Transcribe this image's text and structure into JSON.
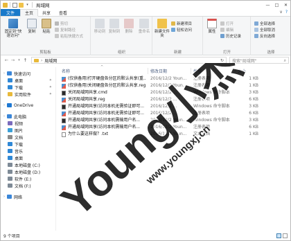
{
  "window": {
    "title": "局域网",
    "controls": [
      "—",
      "□",
      "✕"
    ]
  },
  "ribbon_tabs": {
    "file": "文件",
    "home": "主页",
    "share": "共享",
    "view": "查看",
    "collapse": "∨",
    "help": "?"
  },
  "ribbon": {
    "clipboard": {
      "label": "剪贴板",
      "pin": "固定到\"快速访问\"",
      "copy": "复制",
      "paste": "粘贴",
      "cut": "剪切",
      "copy_path": "复制路径",
      "paste_shortcut": "粘贴快捷方式"
    },
    "organize": {
      "label": "组织",
      "move_to": "移动到",
      "copy_to": "复制到",
      "delete": "删除",
      "rename": "重命名"
    },
    "new": {
      "label": "新建",
      "new_folder": "新建文件夹",
      "new_item": "新建项目",
      "easy_access": "轻松访问"
    },
    "open": {
      "label": "打开",
      "properties": "属性",
      "open": "打开",
      "edit": "编辑",
      "history": "历史记录"
    },
    "select": {
      "label": "选择",
      "select_all": "全部选择",
      "select_none": "全部取消",
      "invert": "反向选择"
    }
  },
  "address": {
    "back": "←",
    "forward": "→",
    "up": "↑",
    "path": "局域网",
    "refresh": "↻",
    "search_placeholder": "搜索\"局域网\"",
    "search_icon": "search-icon"
  },
  "nav_pane": {
    "items": [
      {
        "label": "快速访问",
        "icon": "star-icon",
        "color": "#3a86d8",
        "level": 0,
        "pinned": false
      },
      {
        "label": "桌面",
        "icon": "desktop-icon",
        "color": "#2f88d6",
        "level": 1,
        "pinned": true
      },
      {
        "label": "下载",
        "icon": "download-icon",
        "color": "#2f88d6",
        "level": 1,
        "pinned": true
      },
      {
        "label": "实用软件",
        "icon": "folder-icon",
        "color": "#e8b93a",
        "level": 1,
        "pinned": true
      },
      {
        "label": "OneDrive",
        "icon": "cloud-icon",
        "color": "#1e78d2",
        "level": 0,
        "pinned": false
      },
      {
        "label": "此电脑",
        "icon": "computer-icon",
        "color": "#3a86d8",
        "level": 0,
        "pinned": false
      },
      {
        "label": "视频",
        "icon": "video-icon",
        "color": "#7a6bbd",
        "level": 1,
        "pinned": false
      },
      {
        "label": "图片",
        "icon": "picture-icon",
        "color": "#3aa0d8",
        "level": 1,
        "pinned": false
      },
      {
        "label": "文档",
        "icon": "document-icon",
        "color": "#8a8a8a",
        "level": 1,
        "pinned": false
      },
      {
        "label": "下载",
        "icon": "download-icon",
        "color": "#2f88d6",
        "level": 1,
        "pinned": false
      },
      {
        "label": "音乐",
        "icon": "music-icon",
        "color": "#2f88d6",
        "level": 1,
        "pinned": false
      },
      {
        "label": "桌面",
        "icon": "desktop-icon",
        "color": "#2f88d6",
        "level": 1,
        "pinned": false
      },
      {
        "label": "本地磁盘 (C:)",
        "icon": "drive-icon",
        "color": "#7e8a96",
        "level": 1,
        "pinned": false
      },
      {
        "label": "本地磁盘 (D:)",
        "icon": "drive-icon",
        "color": "#7e8a96",
        "level": 1,
        "pinned": false
      },
      {
        "label": "软件 (E:)",
        "icon": "drive-icon",
        "color": "#7e8a96",
        "level": 1,
        "pinned": false
      },
      {
        "label": "文档 (F:)",
        "icon": "drive-icon",
        "color": "#7e8a96",
        "level": 1,
        "pinned": false
      },
      {
        "label": "网络",
        "icon": "network-icon",
        "color": "#3a86d8",
        "level": 0,
        "pinned": false
      }
    ]
  },
  "file_list": {
    "sort_caret": "^",
    "columns": {
      "name": "名称",
      "date": "修改日期",
      "type": "类型",
      "size": "大小"
    },
    "rows": [
      {
        "name": "(仅供备用)打开硬盘各分区的默认共享(重...",
        "date": "2016/12/2 Youn...",
        "type": "注册表项",
        "size": "1 KB",
        "icon": "reg-icon"
      },
      {
        "name": "(仅供备用)关闭硬盘各分区的默认共享.reg",
        "date": "2016/12/2 Youn...",
        "type": "注册表项",
        "size": "1 KB",
        "icon": "reg-icon"
      },
      {
        "name": "关闭局域网共享.cmd",
        "date": "2016/12/2 ...",
        "type": "Windows 命令脚本",
        "size": "3 KB",
        "icon": "cmd-icon"
      },
      {
        "name": "关闭局域网共享.reg",
        "date": "2016/12/2 ...",
        "type": "注册表项",
        "size": "6 KB",
        "icon": "reg-icon"
      },
      {
        "name": "开通局域网共享(访问本机无需验证即可...",
        "date": "2016/12/2 ...",
        "type": "Windows 命令脚本",
        "size": "3 KB",
        "icon": "cmd-icon"
      },
      {
        "name": "开通局域网共享(访问本机无需验证即可...",
        "date": "2016/12/2 ...",
        "type": "注册表项",
        "size": "6 KB",
        "icon": "reg-icon"
      },
      {
        "name": "开通局域网共享(访问本机需输用户名...",
        "date": "2016/12/2 Youn...",
        "type": "Windows 命令脚本",
        "size": "3 KB",
        "icon": "cmd-icon"
      },
      {
        "name": "开通局域网共享(访问本机需输用户名...",
        "date": "2016/12/2 Youn...",
        "type": "注册表项",
        "size": "6 KB",
        "icon": "reg-icon"
      },
      {
        "name": "为什么要这样做？.txt",
        "date": "2016/12/2 Youn...",
        "type": "文本文档",
        "size": "1 KB",
        "icon": "txt-icon"
      }
    ]
  },
  "status_bar": {
    "count": "9 个项目"
  },
  "watermark": {
    "text_main": "Young小杰",
    "text_url": "www.youngxj.cn"
  },
  "colors": {
    "file_tab": "#1979ca",
    "accent": "#3c7fb1",
    "header_text": "#4d6082",
    "watermark": "#000000"
  }
}
